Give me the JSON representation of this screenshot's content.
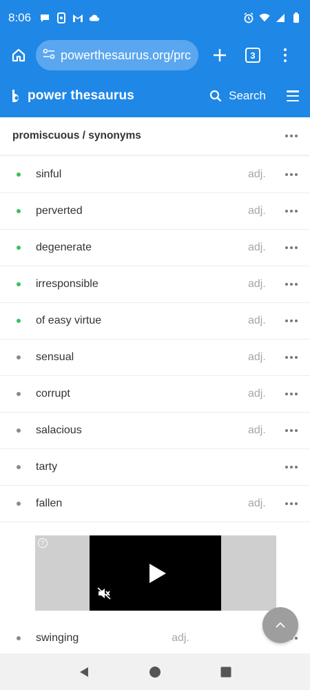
{
  "status_bar": {
    "time": "8:06",
    "left_icons": [
      "chat-bubble-icon",
      "phone-sync-icon",
      "gmail-icon",
      "cloud-icon"
    ],
    "right_icons": [
      "alarm-icon",
      "wifi-icon",
      "signal-icon",
      "battery-icon"
    ]
  },
  "browser": {
    "url": "powerthesaurus.org/prc",
    "tab_count": "3"
  },
  "site": {
    "logo_text": "power thesaurus",
    "search_label": "Search"
  },
  "page": {
    "title": "promiscuous / synonyms"
  },
  "colors": {
    "brand_blue": "#1f87e6",
    "bullet_green": "#3bbf5b",
    "bullet_gray": "#8a8a8a"
  },
  "synonyms": [
    {
      "word": "sinful",
      "pos": "adj.",
      "bullet": "green"
    },
    {
      "word": "perverted",
      "pos": "adj.",
      "bullet": "green"
    },
    {
      "word": "degenerate",
      "pos": "adj.",
      "bullet": "green"
    },
    {
      "word": "irresponsible",
      "pos": "adj.",
      "bullet": "green"
    },
    {
      "word": "of easy virtue",
      "pos": "adj.",
      "bullet": "green"
    },
    {
      "word": "sensual",
      "pos": "adj.",
      "bullet": "gray"
    },
    {
      "word": "corrupt",
      "pos": "adj.",
      "bullet": "gray"
    },
    {
      "word": "salacious",
      "pos": "adj.",
      "bullet": "gray"
    },
    {
      "word": "tarty",
      "pos": "",
      "bullet": "gray"
    },
    {
      "word": "fallen",
      "pos": "adj.",
      "bullet": "gray"
    }
  ],
  "synonyms_after_ad": [
    {
      "word": "swinging",
      "pos": "adj.",
      "bullet": "gray"
    }
  ]
}
